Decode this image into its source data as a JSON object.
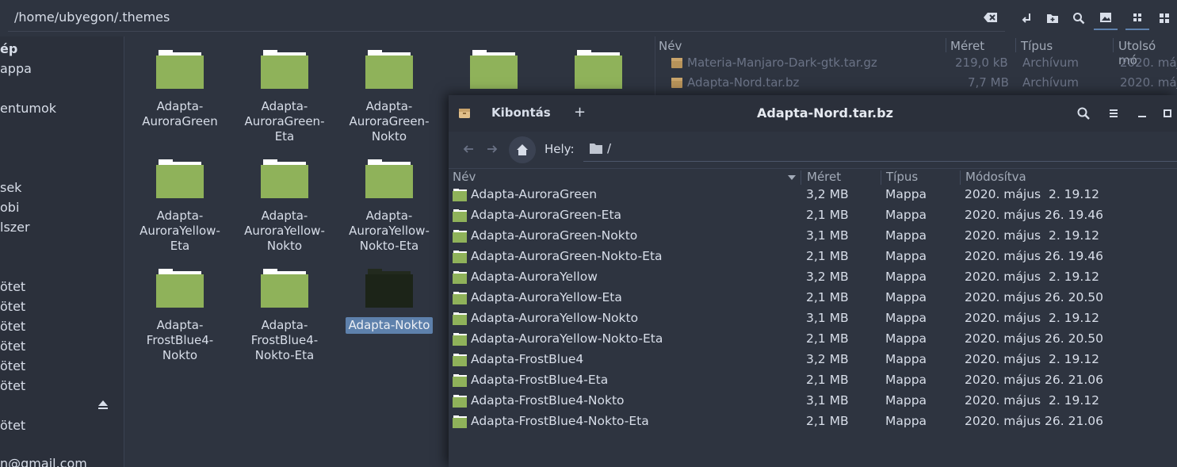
{
  "topbar": {
    "path": "/home/ubyegon/.themes"
  },
  "sidebar": {
    "items": [
      {
        "label": "ép",
        "bold": true
      },
      {
        "label": "appa"
      },
      {
        "label": "entumok"
      },
      {
        "label": "sek"
      },
      {
        "label": "obi"
      },
      {
        "label": "lszer"
      },
      {
        "label": "ötet"
      },
      {
        "label": "ötet"
      },
      {
        "label": "ötet"
      },
      {
        "label": "ötet"
      },
      {
        "label": "ötet"
      },
      {
        "label": "ötet"
      },
      {
        "label": "ötet"
      },
      {
        "label": "n@gmail.com"
      }
    ]
  },
  "grid": {
    "items": [
      {
        "label": "Adapta-\nAuroraGreen"
      },
      {
        "label": "Adapta-\nAuroraGreen-\nEta"
      },
      {
        "label": "Adapta-\nAuroraGreen-\nNokto"
      },
      {
        "label": ""
      },
      {
        "label": ""
      },
      {
        "label": "Adapta-\nAuroraYellow-\nEta"
      },
      {
        "label": "Adapta-\nAuroraYellow-\nNokto"
      },
      {
        "label": "Adapta-\nAuroraYellow-\nNokto-Eta"
      },
      {
        "label": "Adapta-\nFrostBlue4-\nNokto"
      },
      {
        "label": "Adapta-\nFrostBlue4-\nNokto-Eta"
      },
      {
        "label": "Adapta-Nokto",
        "selected": true,
        "dark": true
      }
    ]
  },
  "bg_list": {
    "headers": [
      "Név",
      "Méret",
      "Típus",
      "Utolsó mó"
    ],
    "rows": [
      {
        "name": "Materia-Manjaro-Dark-gtk.tar.gz",
        "size": "219,0 kB",
        "type": "Archívum",
        "date": "2020. máj"
      },
      {
        "name": "Adapta-Nord.tar.bz",
        "size": "7,7 MB",
        "type": "Archívum",
        "date": "2020. máj"
      }
    ]
  },
  "dialog": {
    "extract_label": "Kibontás",
    "add_label": "+",
    "title": "Adapta-Nord.tar.bz",
    "location_label": "Hely:",
    "location_value": "/",
    "columns": [
      "Név",
      "Méret",
      "Típus",
      "Módosítva"
    ],
    "rows": [
      {
        "name": "Adapta-AuroraGreen",
        "size": "3,2 MB",
        "type": "Mappa",
        "date": "2020. május  2. 19.12"
      },
      {
        "name": "Adapta-AuroraGreen-Eta",
        "size": "2,1 MB",
        "type": "Mappa",
        "date": "2020. május 26. 19.46"
      },
      {
        "name": "Adapta-AuroraGreen-Nokto",
        "size": "3,1 MB",
        "type": "Mappa",
        "date": "2020. május  2. 19.12"
      },
      {
        "name": "Adapta-AuroraGreen-Nokto-Eta",
        "size": "2,1 MB",
        "type": "Mappa",
        "date": "2020. május 26. 19.46"
      },
      {
        "name": "Adapta-AuroraYellow",
        "size": "3,2 MB",
        "type": "Mappa",
        "date": "2020. május  2. 19.12"
      },
      {
        "name": "Adapta-AuroraYellow-Eta",
        "size": "2,1 MB",
        "type": "Mappa",
        "date": "2020. május 26. 20.50"
      },
      {
        "name": "Adapta-AuroraYellow-Nokto",
        "size": "3,1 MB",
        "type": "Mappa",
        "date": "2020. május  2. 19.12"
      },
      {
        "name": "Adapta-AuroraYellow-Nokto-Eta",
        "size": "2,1 MB",
        "type": "Mappa",
        "date": "2020. május 26. 20.50"
      },
      {
        "name": "Adapta-FrostBlue4",
        "size": "3,2 MB",
        "type": "Mappa",
        "date": "2020. május  2. 19.12"
      },
      {
        "name": "Adapta-FrostBlue4-Eta",
        "size": "2,1 MB",
        "type": "Mappa",
        "date": "2020. május 26. 21.06"
      },
      {
        "name": "Adapta-FrostBlue4-Nokto",
        "size": "3,1 MB",
        "type": "Mappa",
        "date": "2020. május  2. 19.12"
      },
      {
        "name": "Adapta-FrostBlue4-Nokto-Eta",
        "size": "2,1 MB",
        "type": "Mappa",
        "date": "2020. május 26. 21.06"
      }
    ]
  },
  "colors": {
    "folder_green": "#8fb25a",
    "accent": "#5e81ac",
    "background": "#2e3440"
  },
  "icons": [
    "clear-icon",
    "new-folder-icon",
    "search-icon",
    "image-view-icon",
    "grid-view-icon",
    "menu-icon",
    "eject-icon",
    "archive-icon",
    "home-icon",
    "back-icon",
    "forward-icon",
    "minimize-icon",
    "maximize-icon"
  ]
}
